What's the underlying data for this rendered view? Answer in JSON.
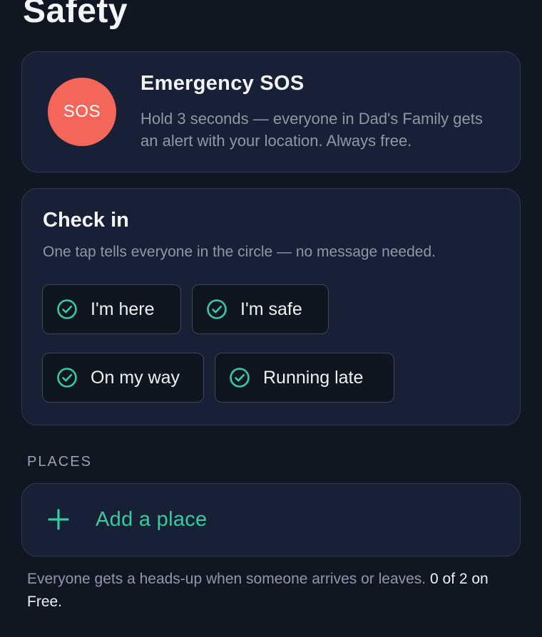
{
  "header": {
    "title": "Safety"
  },
  "sos": {
    "button_label": "SOS",
    "title": "Emergency SOS",
    "description": "Hold 3 seconds — everyone in Dad's Family gets an alert with your location. Always free.",
    "button_color": "#f4655a"
  },
  "checkin": {
    "title": "Check in",
    "description": "One tap tells everyone in the circle — no message needed.",
    "icon": "check-circle-icon",
    "options": [
      {
        "label": "I'm here"
      },
      {
        "label": "I'm safe"
      },
      {
        "label": "On my way"
      },
      {
        "label": "Running late"
      }
    ]
  },
  "places": {
    "section_label": "PLACES",
    "add_label": "Add a place",
    "add_icon": "plus-icon",
    "footnote_prefix": "Everyone gets a heads-up when someone arrives or leaves.",
    "footnote_count": "0 of 2 on Free.",
    "accent_color": "#37c9a0"
  }
}
